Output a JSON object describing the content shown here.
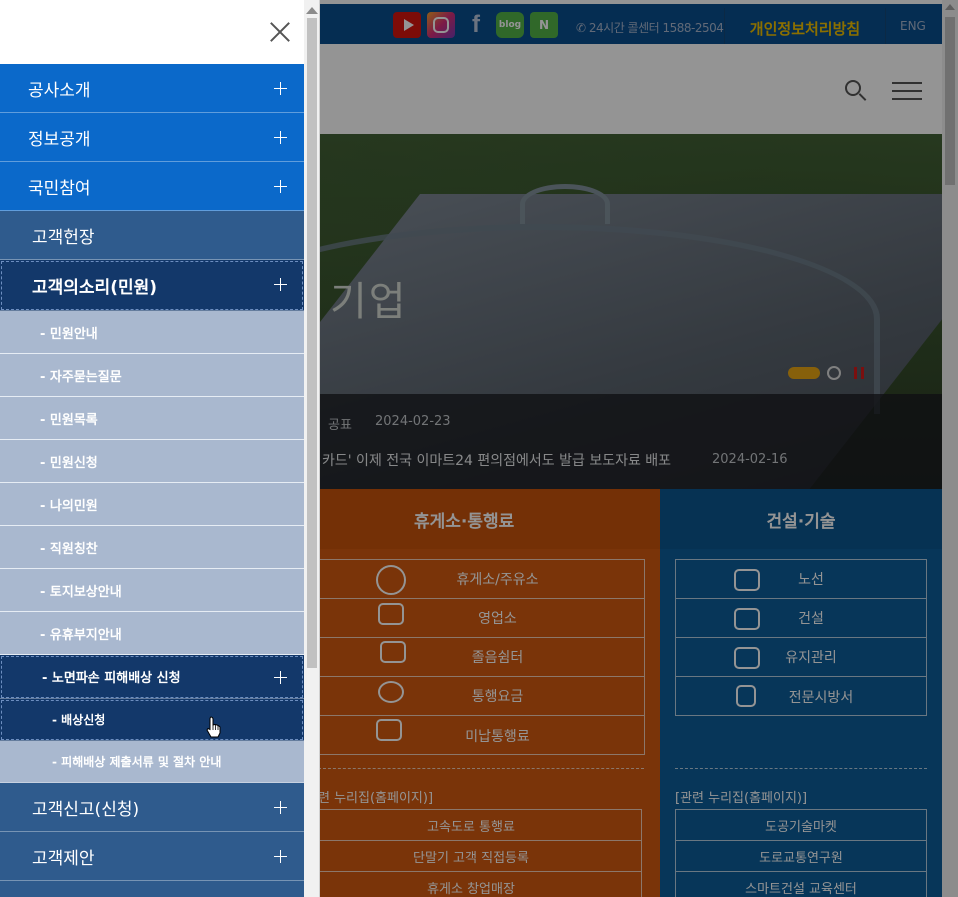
{
  "site": {
    "sns": {
      "youtube_icon": "youtube-icon",
      "instagram_icon": "instagram-icon",
      "facebook_label": "f",
      "blog_label": "blog",
      "naver_label": "N"
    },
    "callcenter": "24시간 콜센터 1588-2504",
    "privacy": "개인정보처리방침",
    "lang": "ENG",
    "hero_text": "기업",
    "news": {
      "category": "공표",
      "date1": "2024-02-23",
      "title": "카드' 이제 전국 이마트24 편의점에서도 발급 보도자료 배포",
      "date2": "2024-02-16"
    },
    "rest_area": {
      "title": "휴게소·통행료",
      "services": [
        "휴게소/주유소",
        "영업소",
        "졸음쉼터",
        "통행요금",
        "미납통행료"
      ],
      "related_label": "련 누리집(홈페이지)]",
      "links": [
        "고속도로 통행료",
        "단말기 고객 직접등록",
        "휴게소 창업매장"
      ]
    },
    "construction": {
      "title": "건설·기술",
      "services": [
        "노선",
        "건설",
        "유지관리",
        "전문시방서"
      ],
      "related_label": "[관련 누리집(홈페이지)]",
      "links": [
        "도공기술마켓",
        "도로교통연구원",
        "스마트건설 교육센터"
      ]
    },
    "colors": {
      "topbar": "#0a4f8e",
      "rest_area": "#d35b10",
      "construction": "#0d5d99",
      "privacy_text": "#f0c000"
    }
  },
  "drawer": {
    "close_icon": "close-icon",
    "menu": [
      {
        "label": "공사소개",
        "type": "l1"
      },
      {
        "label": "정보공개",
        "type": "l1"
      },
      {
        "label": "국민참여",
        "type": "l1"
      },
      {
        "label": "고객헌장",
        "type": "l1d"
      },
      {
        "label": "고객의소리(민원)",
        "type": "sel"
      },
      {
        "label": "- 민원안내",
        "type": "l2"
      },
      {
        "label": "- 자주묻는질문",
        "type": "l2"
      },
      {
        "label": "- 민원목록",
        "type": "l2"
      },
      {
        "label": "- 민원신청",
        "type": "l2"
      },
      {
        "label": "- 나의민원",
        "type": "l2"
      },
      {
        "label": "- 직원칭찬",
        "type": "l2"
      },
      {
        "label": "- 토지보상안내",
        "type": "l2"
      },
      {
        "label": "- 유휴부지안내",
        "type": "l2"
      },
      {
        "label": "- 노면파손 피해배상 신청",
        "type": "l2sel"
      },
      {
        "label": "- 배상신청",
        "type": "l3sel"
      },
      {
        "label": "- 피해배상 제출서류 및 절차 안내",
        "type": "l3"
      },
      {
        "label": "고객신고(신청)",
        "type": "l1d"
      },
      {
        "label": "고객제안",
        "type": "l1d"
      }
    ],
    "colors": {
      "l1": "#0b69ca",
      "l1d": "#2f5b8d",
      "selected": "#13386a",
      "sub": "#a9b8cf"
    }
  }
}
